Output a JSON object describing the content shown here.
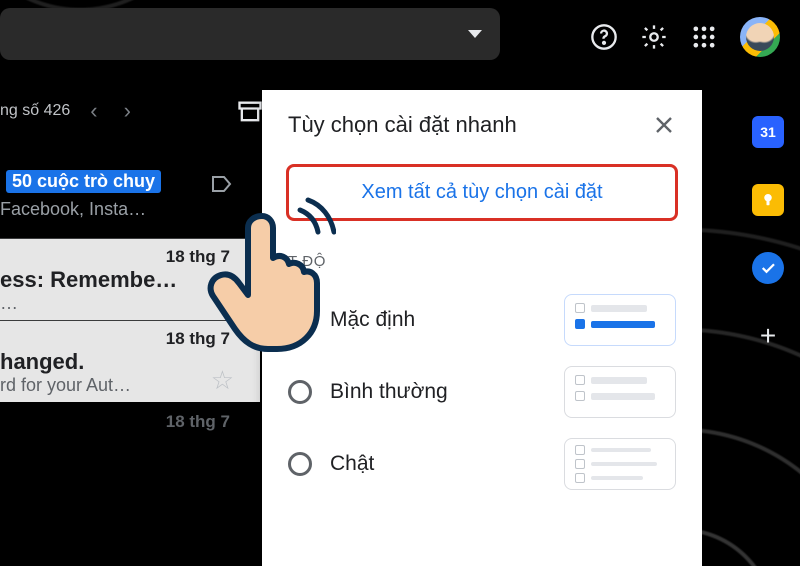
{
  "header": {
    "icons": {
      "help": "help-icon",
      "settings": "gear-icon",
      "apps": "apps-grid-icon",
      "avatar": "avatar"
    }
  },
  "inbox": {
    "pager_text": "ng số 426",
    "chip": "50 cuộc trò chuy",
    "chip_sub": "Facebook, Insta…",
    "rows": [
      {
        "date": "18 thg 7",
        "subject": "ess: Remembe…",
        "snippet": "…"
      },
      {
        "date": "18 thg 7",
        "subject": "hanged.",
        "snippet": "rd for your Aut…"
      }
    ],
    "trailing_date": "18 thg 7"
  },
  "panel": {
    "title": "Tùy chọn cài đặt nhanh",
    "all_settings": "Xem tất cả tùy chọn cài đặt",
    "section_density": "T ĐỘ",
    "options": [
      {
        "label": "Mặc định",
        "selected": true
      },
      {
        "label": "Bình thường",
        "selected": false
      },
      {
        "label": "Chật",
        "selected": false
      }
    ]
  },
  "siderail": {
    "calendar_day": "31"
  }
}
